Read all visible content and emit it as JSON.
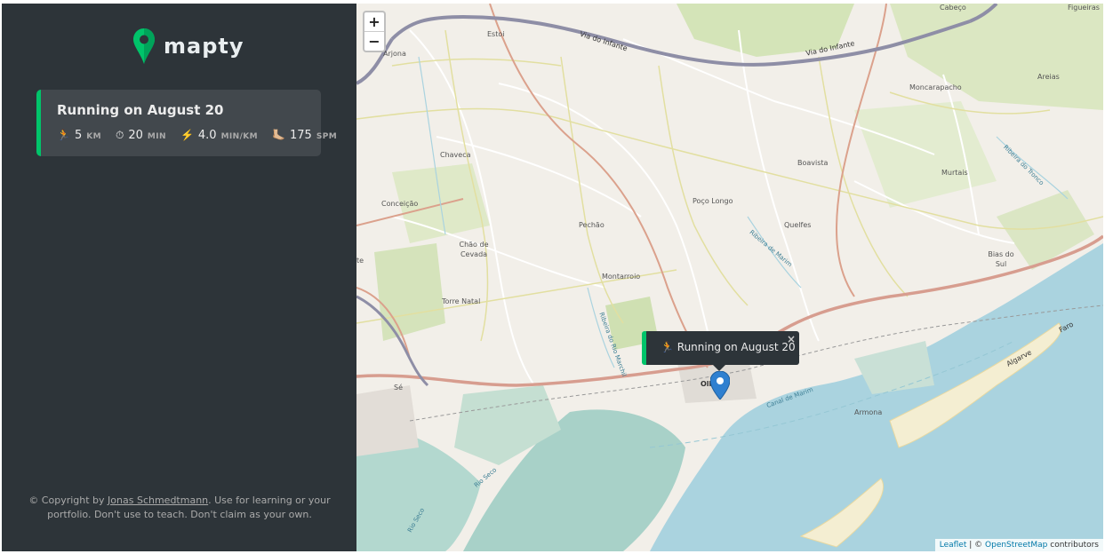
{
  "app": {
    "name": "mapty"
  },
  "workout": {
    "title": "Running on August 20",
    "distance": {
      "icon": "🏃",
      "value": "5",
      "unit": "KM"
    },
    "duration": {
      "icon": "⏱",
      "value": "20",
      "unit": "MIN"
    },
    "pace": {
      "icon": "⚡️",
      "value": "4.0",
      "unit": "MIN/KM"
    },
    "cadence": {
      "icon": "🦶🏼",
      "value": "175",
      "unit": "SPM"
    }
  },
  "footer": {
    "prefix": "© Copyright by ",
    "author": "Jonas Schmedtmann",
    "suffix": ". Use for learning or your portfolio. Don't use to teach. Don't claim as your own."
  },
  "map": {
    "zoom_in": "+",
    "zoom_out": "−",
    "popup": {
      "icon": "🏃",
      "text": "Running on August 20",
      "close": "×"
    },
    "attribution": {
      "leaflet": "Leaflet",
      "separator": " | © ",
      "osm": "OpenStreetMap",
      "contributors": " contributors"
    },
    "places": {
      "arjona": "Arjona",
      "estoi": "Estoi",
      "cabeco": "Cabeço",
      "figueiras": "Figueiras",
      "moncarapacho": "Moncarapacho",
      "areias": "Areias",
      "chaveca": "Chaveca",
      "boavista": "Boavista",
      "murtais": "Murtais",
      "conceicao": "Conceição",
      "poco_longo": "Poço Longo",
      "pechao": "Pechão",
      "quelfes": "Quelfes",
      "chao_de_cevada": "Chão de Cevada",
      "bias_do_sul": "Bias do Sul",
      "te": "te",
      "montarroio": "Montarroio",
      "torre_natal": "Torre Natal",
      "olhao": "Olhão",
      "armona": "Armona",
      "se": "Sé"
    },
    "roads": {
      "via_do_infante_1": "Via do Infante",
      "via_do_infante_2": "Via do Infante",
      "algarve": "Algarve",
      "faro": "Faro"
    },
    "water": {
      "ribeira_marim": "Ribeira de Marim",
      "ribeira_tronco": "Ribeira do Tronco",
      "ribeira_marchil": "Ribeira do Rio Marchil",
      "canal_marim": "Canal de Marim",
      "rio_seco": "Rio Seco",
      "rio_seco_2": "Rio Seco"
    }
  }
}
